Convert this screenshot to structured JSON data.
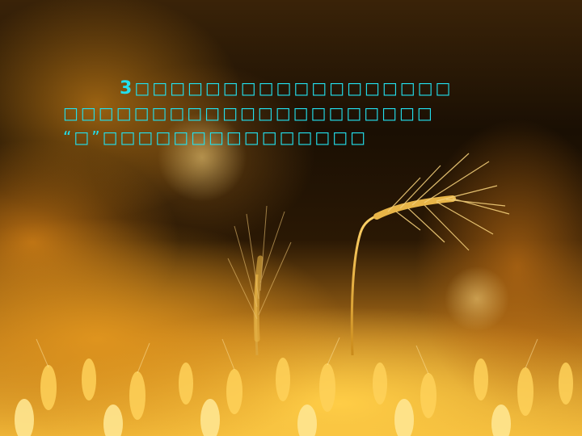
{
  "slide": {
    "text_lines": [
      {
        "lead": "3",
        "text": "□□□□□□□□□□□□□□□□□□"
      },
      {
        "lead": "",
        "text": "□□□□□□□□□□□□□□□□□□□□□"
      },
      {
        "lead": "“□”",
        "text": "□□□□□□□□□□□□□□□"
      }
    ],
    "text_color": "#22e0ee",
    "background_image": "golden-wheat-field-photo"
  }
}
